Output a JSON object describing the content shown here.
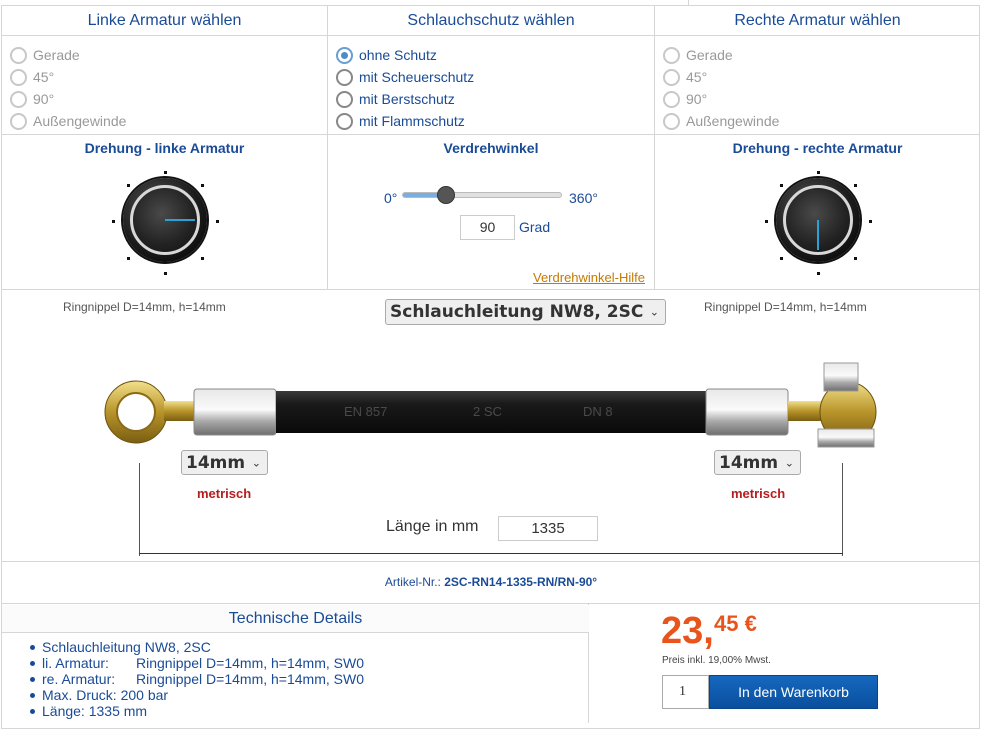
{
  "left_fitting": {
    "title": "Linke Armatur wählen",
    "options": [
      "Gerade",
      "45°",
      "90°",
      "Außengewinde"
    ]
  },
  "hose_protection": {
    "title": "Schlauchschutz wählen",
    "options": [
      "ohne Schutz",
      "mit Scheuerschutz",
      "mit Berstschutz",
      "mit Flammschutz"
    ],
    "selected": "ohne Schutz"
  },
  "right_fitting": {
    "title": "Rechte Armatur wählen",
    "options": [
      "Gerade",
      "45°",
      "90°",
      "Außengewinde"
    ]
  },
  "rotation_left": {
    "title": "Drehung - linke Armatur"
  },
  "rotation_right": {
    "title": "Drehung - rechte Armatur"
  },
  "twist": {
    "title": "Verdrehwinkel",
    "min_label": "0°",
    "max_label": "360°",
    "value": "90",
    "unit": "Grad",
    "help_link": "Verdrehwinkel-Hilfe",
    "fraction": 0.25
  },
  "assembly": {
    "left_nipple": "Ringnippel D=14mm, h=14mm",
    "right_nipple": "Ringnippel D=14mm, h=14mm",
    "hose_select": "Schlauchleitung NW8, 2SC",
    "hose_print": [
      "EN 857",
      "2 SC",
      "DN 8"
    ],
    "left_size": "14mm",
    "right_size": "14mm",
    "left_system": "metrisch",
    "right_system": "metrisch",
    "length_label": "Länge in mm",
    "length_value": "1335"
  },
  "article": {
    "label": "Artikel-Nr.:",
    "number": "2SC-RN14-1335-RN/RN-90°"
  },
  "details": {
    "title": "Technische Details",
    "items": [
      {
        "key": "",
        "value": "Schlauchleitung NW8, 2SC"
      },
      {
        "key": "li. Armatur:",
        "value": "Ringnippel D=14mm, h=14mm, SW0"
      },
      {
        "key": "re. Armatur:",
        "value": "Ringnippel D=14mm, h=14mm, SW0"
      },
      {
        "key": "",
        "value": "Max. Druck: 200 bar"
      },
      {
        "key": "",
        "value": "Länge: 1335 mm"
      }
    ]
  },
  "price": {
    "euros": "23,",
    "cents_currency": "45 €",
    "tax_note": "Preis inkl. 19,00% Mwst.",
    "quantity": "1",
    "cart_button": "In den Warenkorb"
  },
  "colors": {
    "heading": "#1a4b97",
    "price": "#e8541c",
    "metric": "#b81d1d",
    "button": "#0a5cb0",
    "knob_indicator": "#29a3d6"
  }
}
